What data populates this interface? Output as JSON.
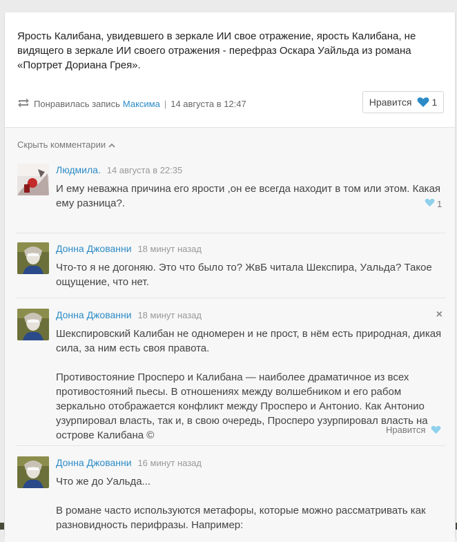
{
  "post": {
    "text": "Ярость Калибана, увидевшего в зеркале ИИ свое отражение, ярость Калибана, не видящего в зеркале ИИ своего отражения - перефраз Оскара Уайльда из романа «Портрет Дориана Грея».",
    "repost_prefix": "Понравилась запись",
    "repost_author": "Максима",
    "separator": "|",
    "repost_time": "14 августа в 12:47",
    "like_label": "Нравится",
    "like_count": "1",
    "heart_color": "#2b8bc6"
  },
  "comments_section": {
    "hide_label": "Скрыть комментарии",
    "items": [
      {
        "author": "Людмила.",
        "time": "14 августа в 22:35",
        "paragraphs": [
          "И ему неважна причина его ярости ,он ее всегда находит в том или этом. Какая ему разница?."
        ],
        "like_count": "1"
      },
      {
        "author": "Донна Джованни",
        "time": "18 минут назад",
        "paragraphs": [
          "Что-то я не догоняю. Это что было то? ЖвБ читала Шекспира, Уальда? Такое ощущение, что нет."
        ]
      },
      {
        "author": "Донна Джованни",
        "time": "18 минут назад",
        "paragraphs": [
          "Шекспировский Калибан не одномерен и не прост, в нём есть природная, дикая сила, за ним есть своя правота.",
          "Противостояние Просперо и Калибана — наиболее драматичное из всех противостояний пьесы. В отношениях между волшебником и его рабом зеркально отображается конфликт между Просперо и Антонио. Как Антонио узурпировал власть, так и, в свою очередь, Просперо узурпировал власть на острове Калибана ©"
        ],
        "like_label": "Нравится",
        "close_glyph": "×"
      },
      {
        "author": "Донна Джованни",
        "time": "16 минут назад",
        "paragraphs": [
          "Что же до Уальда...",
          "В романе часто используются метафоры, которые можно рассматривать как разновидность перифразы. Например:"
        ]
      }
    ]
  },
  "icons": {
    "repost": "repost-icon",
    "heart": "heart-icon",
    "chevron": "chevron-up-icon",
    "close": "close-icon"
  },
  "colors": {
    "link": "#2b8bc6",
    "heart_light": "#8fd0ec"
  }
}
